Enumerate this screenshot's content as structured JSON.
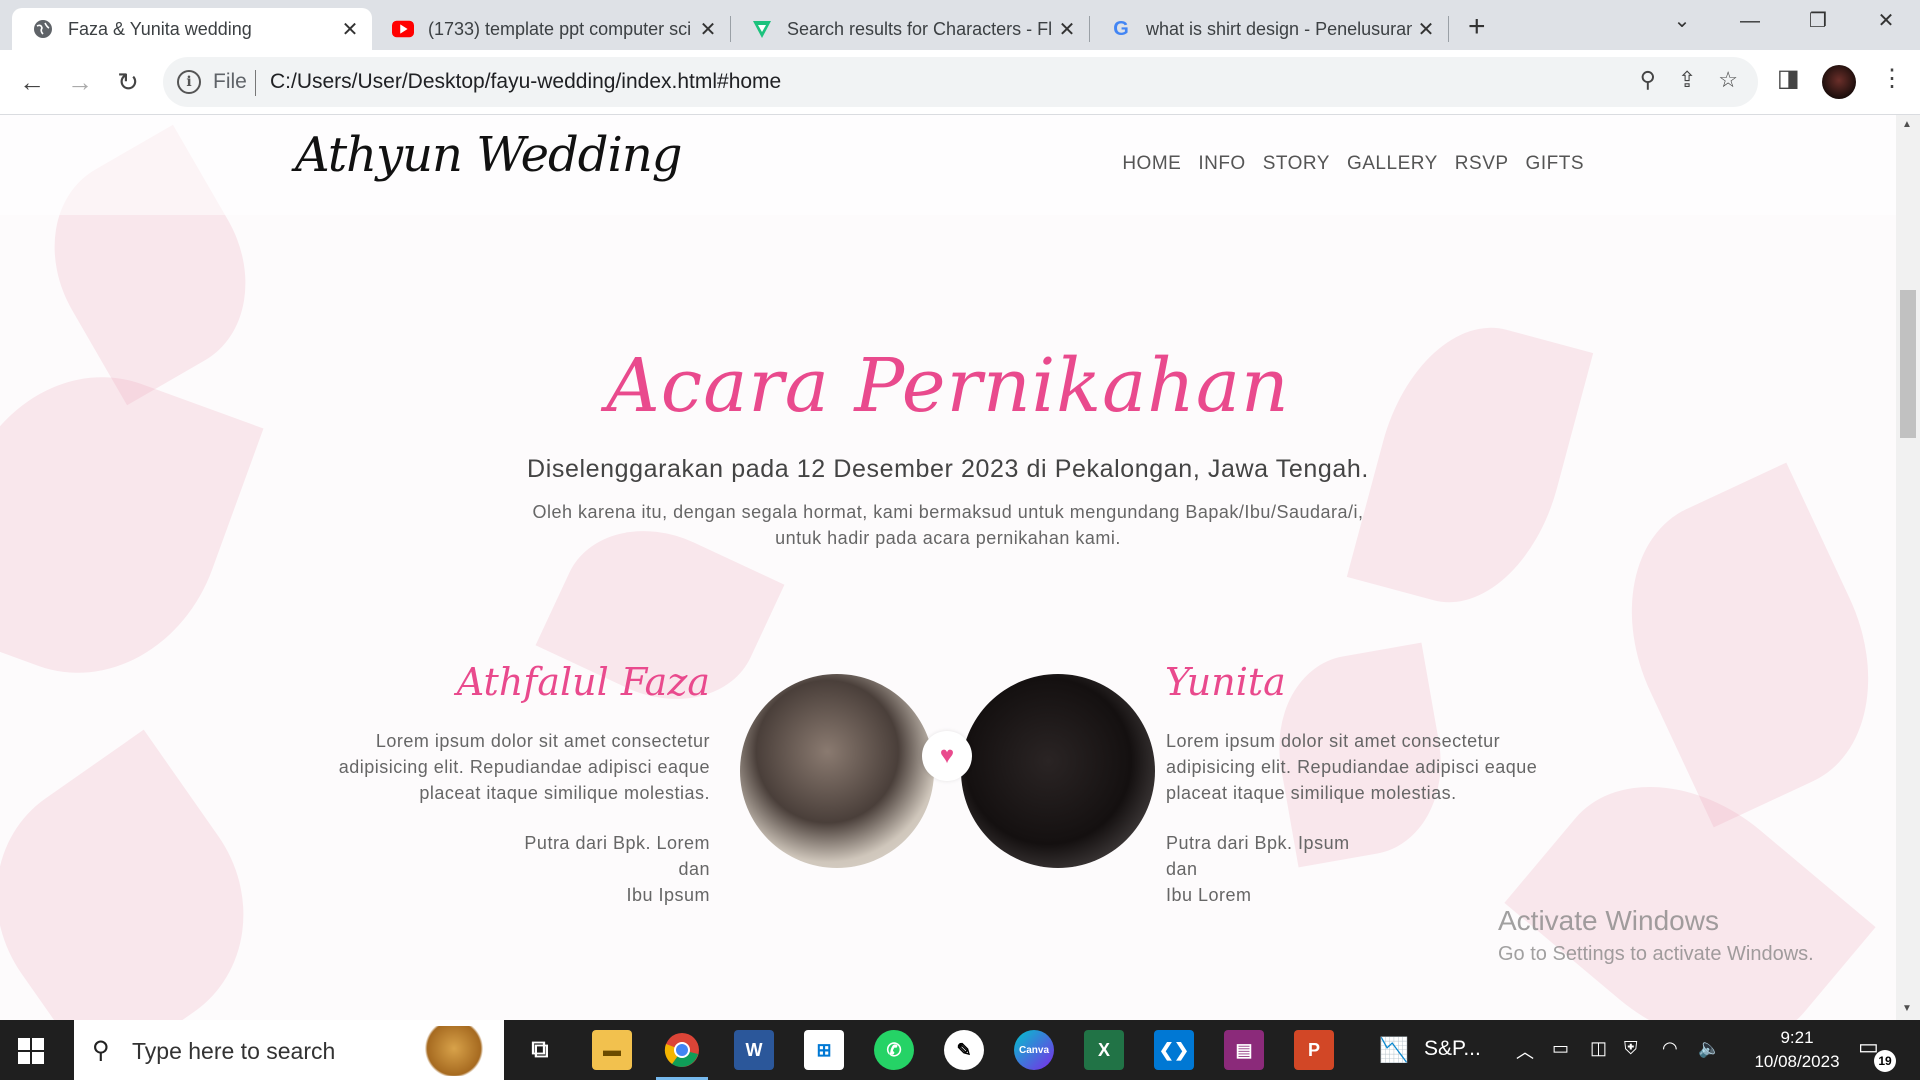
{
  "browser": {
    "tabs": [
      {
        "title": "Faza & Yunita wedding",
        "icon": "globe-icon",
        "active": true
      },
      {
        "title": "(1733) template ppt computer sci",
        "icon": "youtube-icon",
        "active": false
      },
      {
        "title": "Search results for Characters - Fla",
        "icon": "freepik-icon",
        "active": false
      },
      {
        "title": "what is shirt design - Penelusuran",
        "icon": "google-icon",
        "active": false
      }
    ],
    "new_tab_label": "+",
    "address": {
      "scheme_label": "File",
      "url": "C:/Users/User/Desktop/fayu-wedding/index.html#home"
    }
  },
  "site": {
    "logo": "Athyun Wedding",
    "nav": [
      "HOME",
      "INFO",
      "STORY",
      "GALLERY",
      "RSVP",
      "GIFTS"
    ],
    "event": {
      "title": "Acara Pernikahan",
      "subtitle": "Diselenggarakan pada 12 Desember 2023 di Pekalongan, Jawa Tengah.",
      "invite_line1": "Oleh karena itu, dengan segala hormat, kami bermaksud untuk mengundang Bapak/Ibu/Saudara/i,",
      "invite_line2": "untuk hadir pada acara pernikahan kami."
    },
    "groom": {
      "name": "Athfalul Faza",
      "bio_line1": "Lorem ipsum dolor sit amet consectetur",
      "bio_line2": "adipisicing elit. Repudiandae adipisci eaque",
      "bio_line3": "placeat itaque similique molestias.",
      "parents_line1": "Putra dari Bpk. Lorem",
      "parents_line2": "dan",
      "parents_line3": "Ibu Ipsum"
    },
    "bride": {
      "name": "Yunita",
      "bio_line1": "Lorem ipsum dolor sit amet consectetur",
      "bio_line2": "adipisicing elit. Repudiandae adipisci eaque",
      "bio_line3": "placeat itaque similique molestias.",
      "parents_line1": "Putra dari Bpk. Ipsum",
      "parents_line2": "dan",
      "parents_line3": "Ibu Lorem"
    },
    "accent_color": "#e94a8d"
  },
  "watermark": {
    "line1": "Activate Windows",
    "line2": "Go to Settings to activate Windows."
  },
  "taskbar": {
    "search_placeholder": "Type here to search",
    "pinned_label": "S&P...",
    "time": "9:21",
    "date": "10/08/2023",
    "notification_count": "19"
  }
}
